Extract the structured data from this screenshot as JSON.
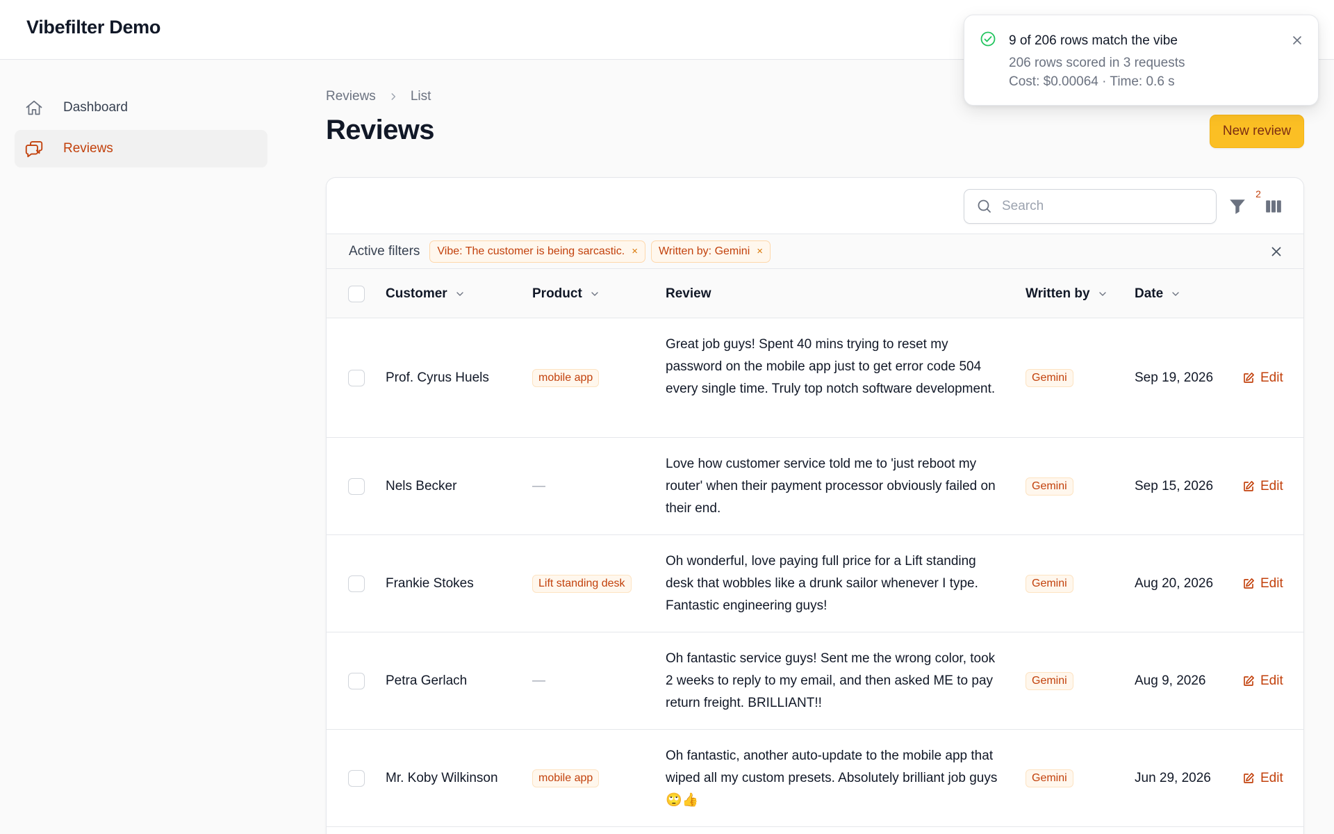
{
  "app": {
    "title": "Vibefilter Demo"
  },
  "sidebar": {
    "items": [
      {
        "label": "Dashboard",
        "icon": "home-icon",
        "active": false
      },
      {
        "label": "Reviews",
        "icon": "chat-bubbles-icon",
        "active": true
      }
    ]
  },
  "breadcrumb": {
    "items": [
      "Reviews",
      "List"
    ]
  },
  "page": {
    "title": "Reviews",
    "new_button": "New review"
  },
  "toolbar": {
    "search_placeholder": "Search",
    "search_value": "",
    "filter_count": "2"
  },
  "active_filters": {
    "label": "Active filters",
    "chips": [
      "Vibe: The customer is being sarcastic.",
      "Written by: Gemini"
    ],
    "chip_remove": "×"
  },
  "table": {
    "columns": {
      "customer": "Customer",
      "product": "Product",
      "review": "Review",
      "written_by": "Written by",
      "date": "Date"
    },
    "edit_label": "Edit",
    "empty_product": "—",
    "rows": [
      {
        "customer": "Prof. Cyrus Huels",
        "product": "mobile app",
        "review": "Great job guys! Spent 40 mins trying to reset my password on the mobile app just to get error code 504 every single time. Truly top notch software development.",
        "written_by": "Gemini",
        "date": "Sep 19, 2026"
      },
      {
        "customer": "Nels Becker",
        "product": "",
        "review": "Love how customer service told me to 'just reboot my router' when their payment processor obviously failed on their end.",
        "written_by": "Gemini",
        "date": "Sep 15, 2026"
      },
      {
        "customer": "Frankie Stokes",
        "product": "Lift standing desk",
        "review": "Oh wonderful, love paying full price for a Lift standing desk that wobbles like a drunk sailor whenever I type. Fantastic engineering guys!",
        "written_by": "Gemini",
        "date": "Aug 20, 2026"
      },
      {
        "customer": "Petra Gerlach",
        "product": "",
        "review": "Oh fantastic service guys! Sent me the wrong color, took 2 weeks to reply to my email, and then asked ME to pay return freight. BRILLIANT!!",
        "written_by": "Gemini",
        "date": "Aug 9, 2026"
      },
      {
        "customer": "Mr. Koby Wilkinson",
        "product": "mobile app",
        "review": "Oh fantastic, another auto-update to the mobile app that wiped all my custom presets. Absolutely brilliant job guys 🙄👍",
        "written_by": "Gemini",
        "date": "Jun 29, 2026"
      }
    ]
  },
  "toast": {
    "title": "9 of 206 rows match the vibe",
    "line1": "206 rows scored in 3 requests",
    "line2": "Cost: $0.00064 · Time: 0.6 s"
  },
  "colors": {
    "accent": "#c2410c",
    "button_bg": "#fbbf24",
    "success": "#22c55e"
  }
}
